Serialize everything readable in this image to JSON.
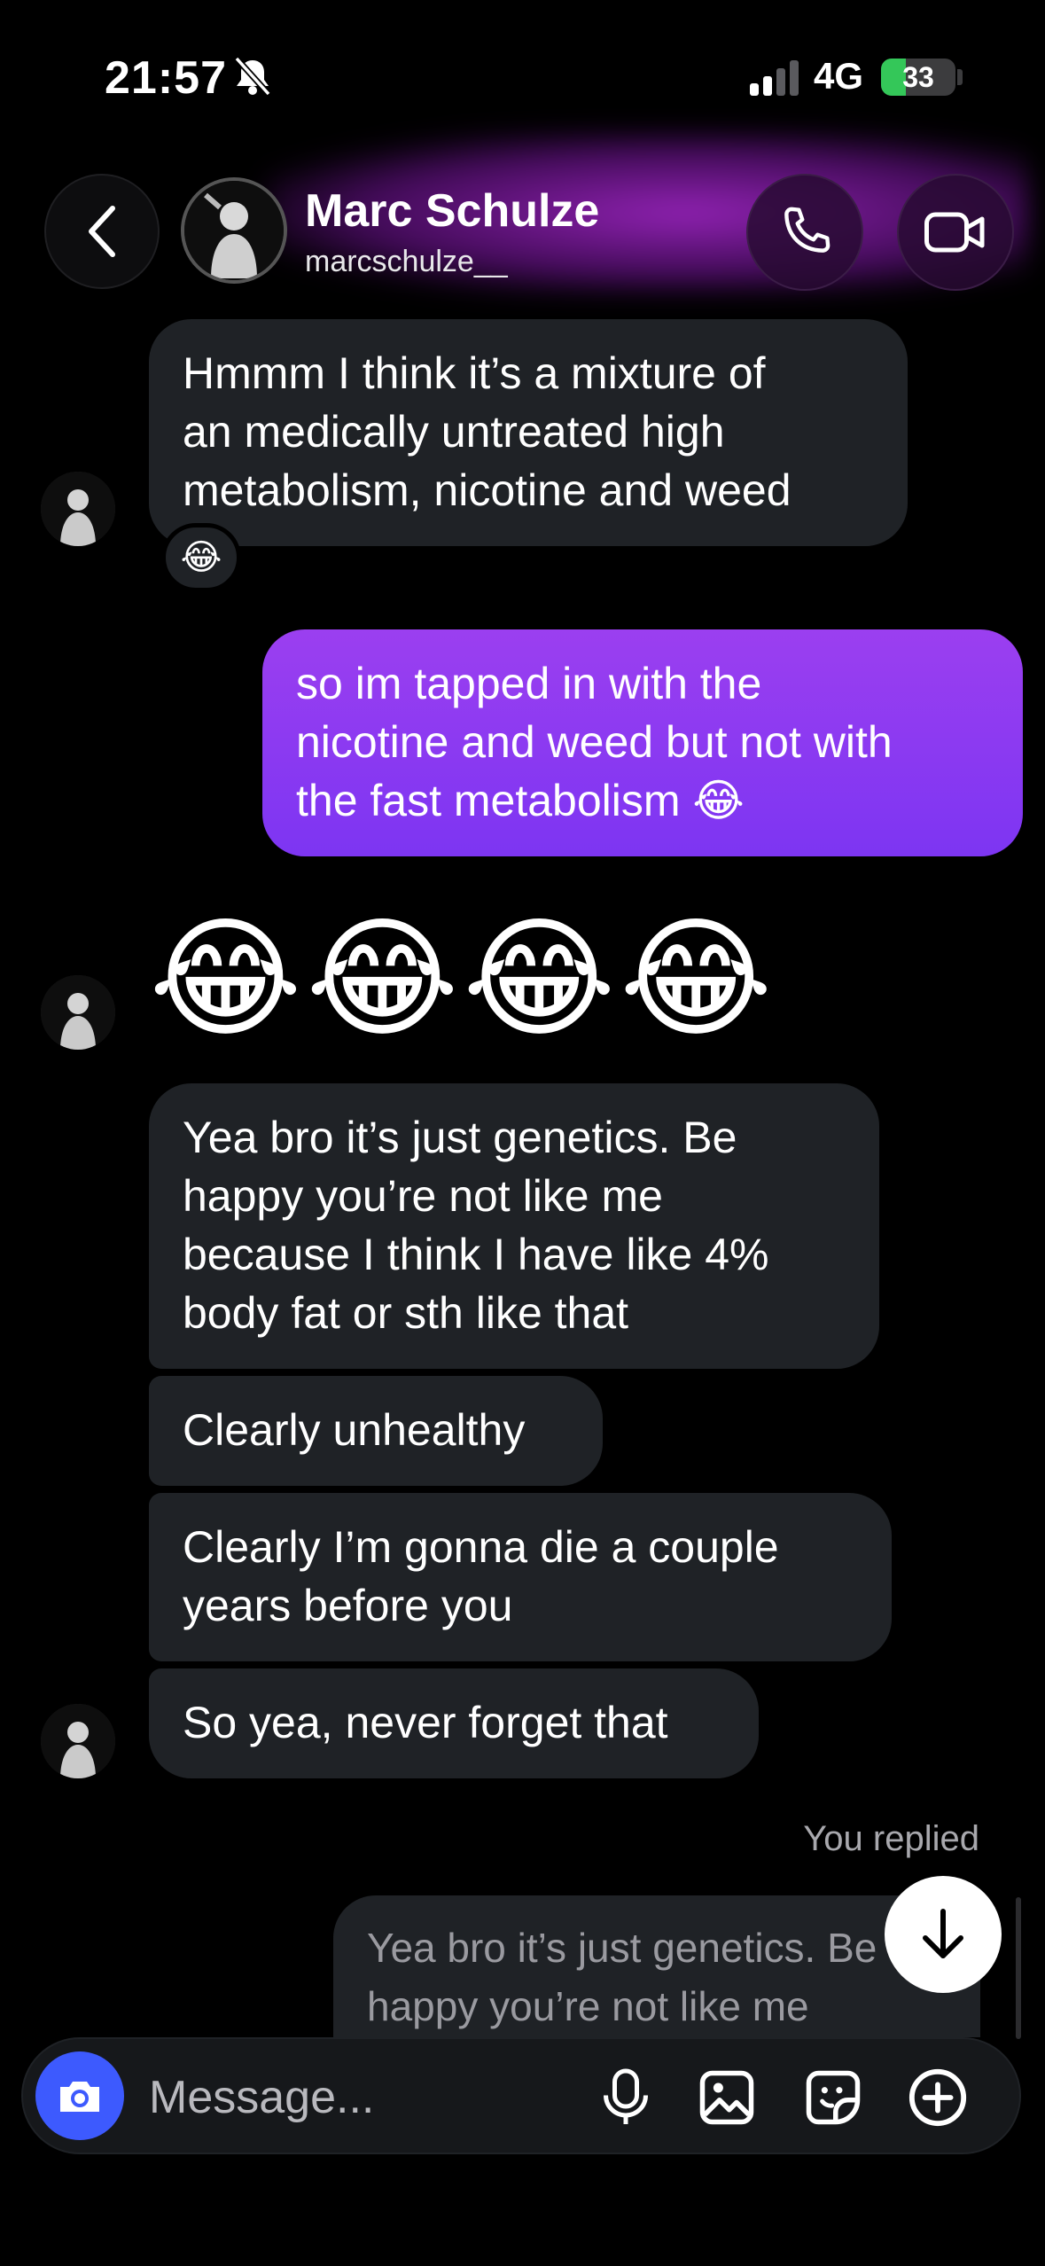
{
  "status_bar": {
    "time": "21:57",
    "network": "4G",
    "battery": "33",
    "battery_level": 0.33,
    "battery_color": "#34c759",
    "icons": [
      "bell-slash-icon",
      "signal-icon",
      "battery-charging-icon"
    ]
  },
  "header": {
    "name": "Marc Schulze",
    "handle": "marcschulze__",
    "icons": [
      "chevron-left-icon",
      "phone-icon",
      "video-camera-icon"
    ],
    "accent": "#a52ad2"
  },
  "messages": {
    "m1": "Hmmm I think it’s a mixture of\nan medically untreated high\nmetabolism, nicotine and weed",
    "m1_reaction": "😂",
    "m2": "so im tapped in with the\nnicotine and weed but not with\nthe fast metabolism 😂",
    "m3": "😂😂😂😂",
    "m4": "Yea bro it’s just genetics. Be\nhappy you’re not like me\nbecause I think I have like 4%\nbody fat or sth like that",
    "m5": "Clearly unhealthy",
    "m6": "Clearly I’m gonna die a couple\nyears before you",
    "m7": "So yea, never forget that",
    "replied_label": "You replied",
    "reply_quote": "Yea bro it’s just genetics. Be\nhappy you’re not like me"
  },
  "composer": {
    "placeholder": "Message...",
    "icons": [
      "camera-icon",
      "microphone-icon",
      "image-icon",
      "sticker-icon",
      "plus-circle-icon"
    ],
    "camera_color": "#3d5afe"
  },
  "colors": {
    "incoming_bubble": "#1f2226",
    "outgoing_bubble": "#8a3bf0"
  }
}
